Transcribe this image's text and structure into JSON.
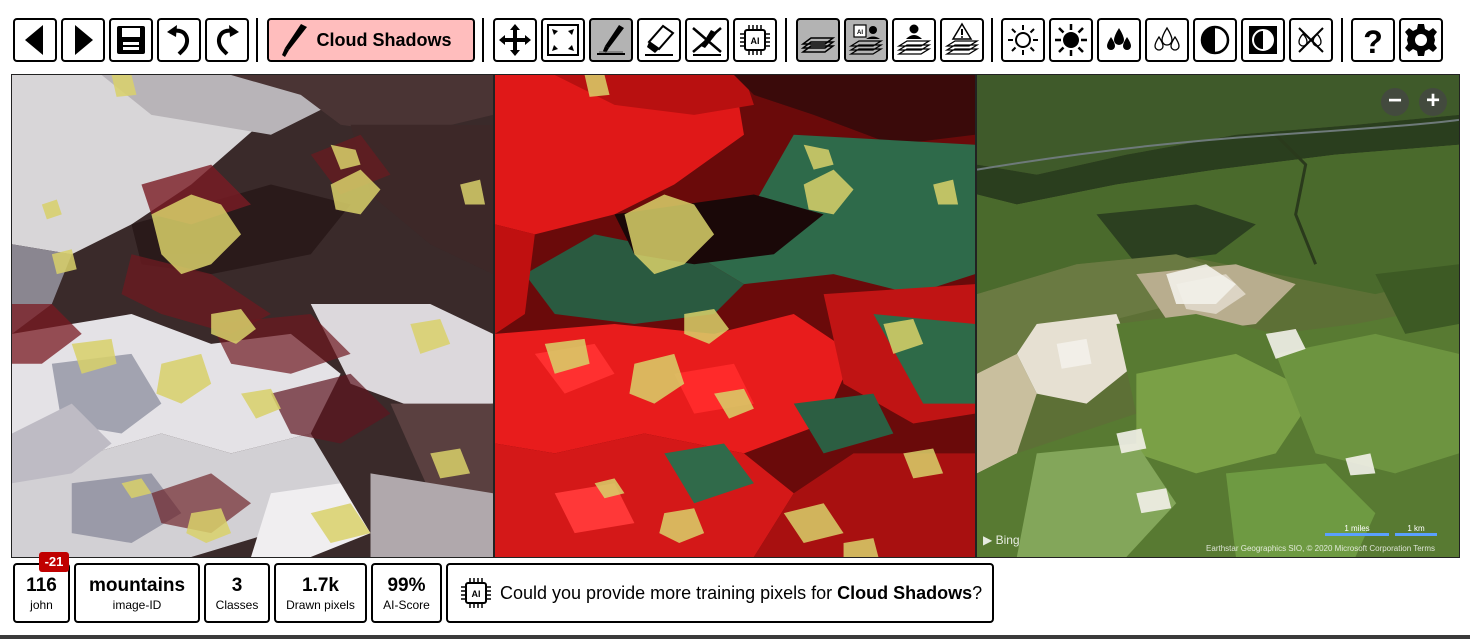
{
  "toolbar": {
    "class_label": "Cloud Shadows",
    "buttons": [
      {
        "name": "back-icon"
      },
      {
        "name": "forward-icon"
      },
      {
        "name": "save-icon"
      },
      {
        "name": "undo-icon"
      },
      {
        "name": "redo-icon"
      },
      {
        "name": "pan-icon"
      },
      {
        "name": "fit-to-screen-icon"
      },
      {
        "name": "brush-draw-icon",
        "active": true
      },
      {
        "name": "eraser-icon"
      },
      {
        "name": "clear-drawing-icon"
      },
      {
        "name": "ai-chip-icon"
      },
      {
        "name": "layer-flat-icon",
        "active": true
      },
      {
        "name": "layer-ai-icon",
        "active": true
      },
      {
        "name": "layer-person-icon"
      },
      {
        "name": "layer-warning-icon"
      },
      {
        "name": "brightness-low-icon"
      },
      {
        "name": "brightness-high-icon"
      },
      {
        "name": "saturation-up-icon"
      },
      {
        "name": "saturation-down-icon"
      },
      {
        "name": "contrast-icon"
      },
      {
        "name": "contrast-inverse-icon"
      },
      {
        "name": "reset-adjust-icon"
      },
      {
        "name": "help-icon"
      },
      {
        "name": "settings-icon"
      }
    ]
  },
  "map": {
    "provider_label": "Bing",
    "attribution": "Earthstar Geographics SIO, © 2020 Microsoft Corporation  Terms",
    "scale_miles": "1 miles",
    "scale_km": "1 km",
    "zoom_out": "−",
    "zoom_in": "+"
  },
  "stats": {
    "score_value": "116",
    "score_user": "john",
    "delta_badge": "-21",
    "image_id": "mountains",
    "image_id_caption": "image-ID",
    "classes_value": "3",
    "classes_caption": "Classes",
    "pixels_value": "1.7k",
    "pixels_caption": "Drawn pixels",
    "ai_value": "99%",
    "ai_caption": "AI-Score"
  },
  "message": {
    "prefix": "Could you provide more training pixels for ",
    "class_name": "Cloud Shadows",
    "suffix": "?"
  },
  "colors": {
    "class_button_bg": "#ffbdbd",
    "active_button_bg": "#b3b3b3",
    "badge_red": "#c00000",
    "overlay_cloud": "#d9d16a",
    "overlay_shadow": "#8b1a1a"
  }
}
